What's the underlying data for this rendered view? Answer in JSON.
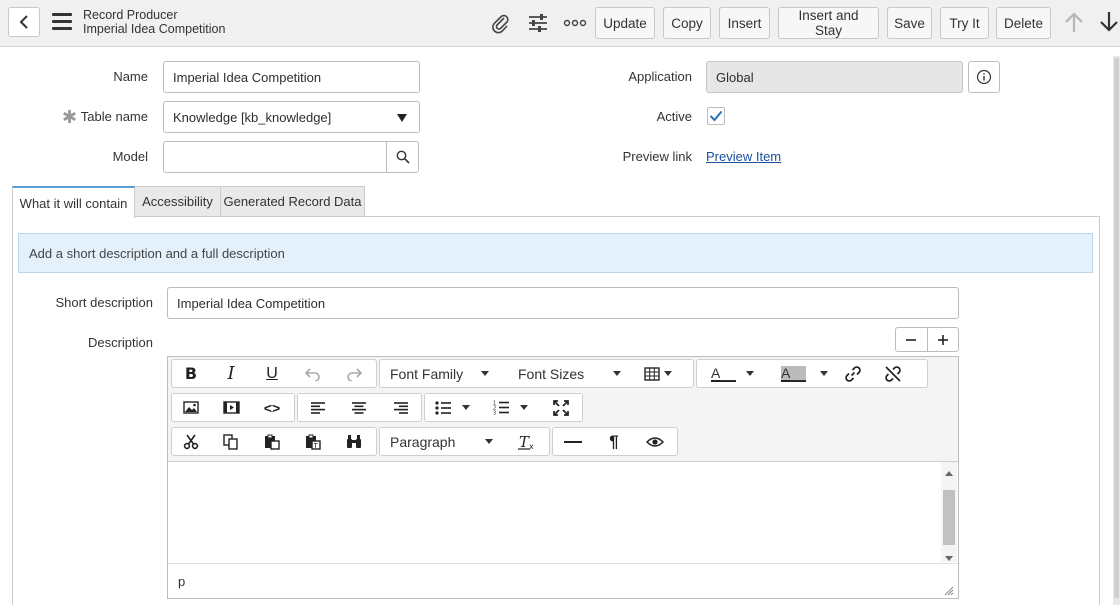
{
  "header": {
    "record_type": "Record Producer",
    "record_name": "Imperial Idea Competition",
    "buttons": [
      "Update",
      "Copy",
      "Insert",
      "Insert and Stay",
      "Save",
      "Try It",
      "Delete"
    ],
    "icons": [
      "back-arrow-icon",
      "hamburger-menu-icon",
      "paperclip-icon",
      "sliders-icon",
      "more-icon",
      "up-arrow-icon",
      "down-arrow-icon"
    ]
  },
  "form": {
    "name_label": "Name",
    "name_value": "Imperial Idea Competition",
    "table_label": "Table name",
    "table_value": "Knowledge [kb_knowledge]",
    "model_label": "Model",
    "model_value": "",
    "application_label": "Application",
    "application_value": "Global",
    "active_label": "Active",
    "active_checked": true,
    "preview_label": "Preview link",
    "preview_link": "Preview Item"
  },
  "tabs": [
    {
      "label": "What it will contain",
      "active": true
    },
    {
      "label": "Accessibility",
      "active": false
    },
    {
      "label": "Generated Record Data",
      "active": false
    }
  ],
  "note": "Add a short description and a full description",
  "short_description_label": "Short description",
  "short_description_value": "Imperial Idea Competition",
  "description_label": "Description",
  "editor": {
    "font_family": "Font Family",
    "font_sizes": "Font Sizes",
    "format": "Paragraph",
    "status_path": "p"
  },
  "colors": {
    "accent": "#5e9ed6",
    "note_bg": "#e4f1fb",
    "link": "#1a4fa0",
    "check": "#2c6fb6"
  }
}
